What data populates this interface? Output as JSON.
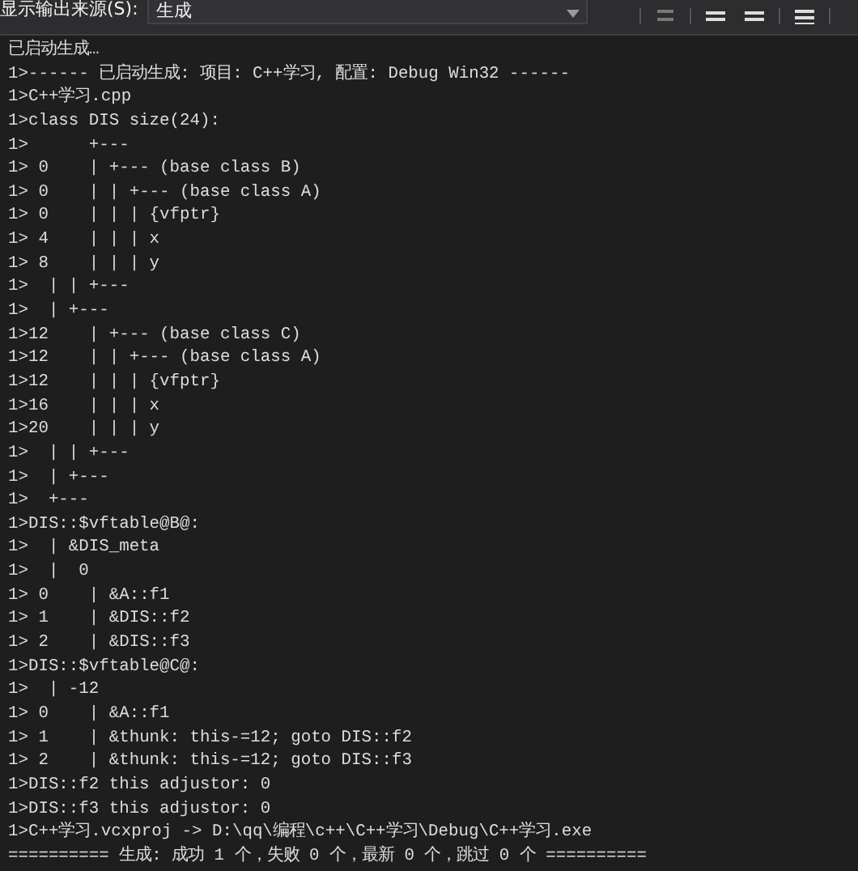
{
  "toolbar": {
    "label": "显示输出来源(S):",
    "source": "生成"
  },
  "output_lines": [
    "已启动生成…",
    "1>------ 已启动生成: 项目: C++学习, 配置: Debug Win32 ------",
    "1>C++学习.cpp",
    "1>class DIS size(24):",
    "1>\t+---",
    "1> 0\t| +--- (base class B)",
    "1> 0\t| | +--- (base class A)",
    "1> 0\t| | | {vfptr}",
    "1> 4\t| | | x",
    "1> 8\t| | | y",
    "1>  | | +---",
    "1>  | +---",
    "1>12\t| +--- (base class C)",
    "1>12\t| | +--- (base class A)",
    "1>12\t| | | {vfptr}",
    "1>16\t| | | x",
    "1>20\t| | | y",
    "1>  | | +---",
    "1>  | +---",
    "1>  +---",
    "1>DIS::$vftable@B@:",
    "1>  | &DIS_meta",
    "1>  |  0",
    "1> 0\t| &A::f1",
    "1> 1\t| &DIS::f2",
    "1> 2\t| &DIS::f3",
    "1>DIS::$vftable@C@:",
    "1>  | -12",
    "1> 0\t| &A::f1",
    "1> 1\t| &thunk: this-=12; goto DIS::f2",
    "1> 2\t| &thunk: this-=12; goto DIS::f3",
    "1>DIS::f2 this adjustor: 0",
    "1>DIS::f3 this adjustor: 0",
    "1>C++学习.vcxproj -> D:\\qq\\编程\\c++\\C++学习\\Debug\\C++学习.exe",
    "========== 生成: 成功 1 个，失败 0 个，最新 0 个，跳过 0 个 =========="
  ]
}
